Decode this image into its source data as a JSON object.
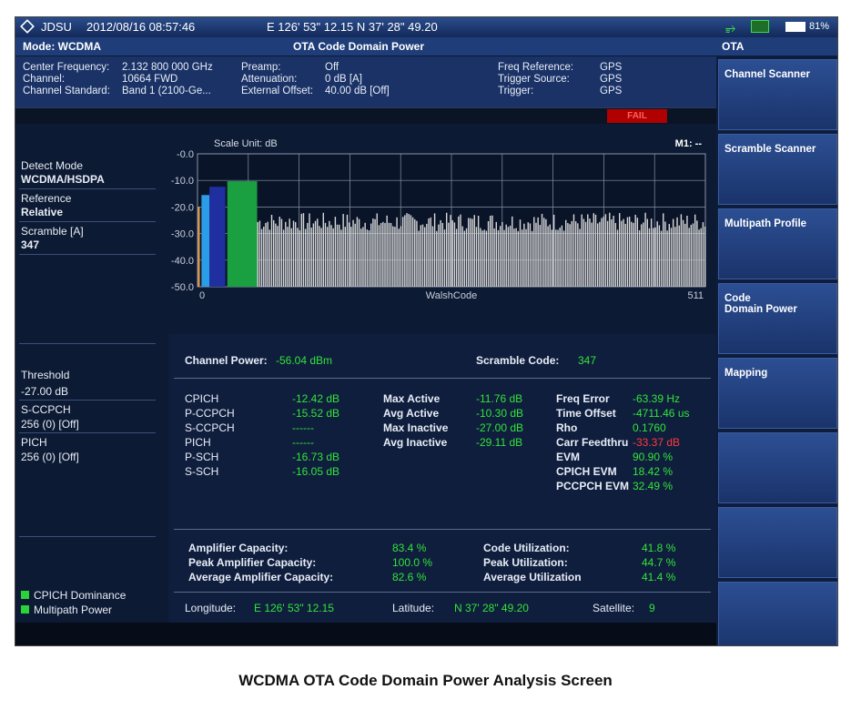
{
  "status": {
    "brand": "JDSU",
    "datetime": "2012/08/16 08:57:46",
    "gps": "E 126' 53\" 12.15  N 37' 28\" 49.20",
    "battery": "81%"
  },
  "header": {
    "mode": "Mode: WCDMA",
    "title": "OTA Code Domain Power"
  },
  "info": {
    "labels1": [
      "Center Frequency:",
      "Channel:",
      "Channel Standard:"
    ],
    "values1": [
      "2.132 800 000 GHz",
      "10664 FWD",
      "Band 1 (2100-Ge..."
    ],
    "labels2": [
      "Preamp:",
      "Attenuation:",
      "External Offset:"
    ],
    "values2": [
      "Off",
      "0 dB  [A]",
      "40.00 dB  [Off]"
    ],
    "labels3": [
      "Freq Reference:",
      "Trigger Source:",
      "Trigger:"
    ],
    "values3": [
      "GPS",
      "GPS",
      "GPS"
    ],
    "fail": "FAIL"
  },
  "left": {
    "detect_label": "Detect Mode",
    "detect_value": "WCDMA/HSDPA",
    "reference_label": "Reference",
    "reference_value": "Relative",
    "scramble_label": "Scramble [A]",
    "scramble_value": "347",
    "threshold_label": "Threshold",
    "threshold_value": "-27.00 dB",
    "sccpch_label": "S-CCPCH",
    "sccpch_value": "256 (0) [Off]",
    "pich_label": "PICH",
    "pich_value": "256 (0) [Off]",
    "legend1": "CPICH Dominance",
    "legend2": "Multipath Power"
  },
  "chart_data": {
    "type": "bar",
    "title": "Scale Unit: dB",
    "marker": "M1: --",
    "xlabel": "WalshCode",
    "x_ticks": [
      "0",
      "511"
    ],
    "y_ticks": [
      "-0.0",
      "-10.0",
      "-20.0",
      "-30.0",
      "-40.0",
      "-50.0"
    ],
    "ylim": [
      -50,
      0
    ],
    "xlim": [
      0,
      511
    ],
    "grid": true,
    "highlight_bars": [
      {
        "name": "P-CCPCH",
        "x_start": 4,
        "x_end": 12,
        "value": -15.5,
        "color": "#2b9de8"
      },
      {
        "name": "CPICH",
        "x_start": 12,
        "x_end": 28,
        "value": -12.4,
        "color": "#1f2fa0"
      },
      {
        "name": "S-CCPCH",
        "x_start": 30,
        "x_end": 60,
        "value": -10.3,
        "color": "#1aa040"
      }
    ],
    "noise_floor": -27.0,
    "noise_spread": 3.5,
    "noise_color": "#d8d8d8"
  },
  "meas": {
    "channel_power_label": "Channel Power:",
    "channel_power_value": "-56.04 dBm",
    "scramble_code_label": "Scramble Code:",
    "scramble_code_value": "347",
    "ch_names": [
      "CPICH",
      "P-CCPCH",
      "S-CCPCH",
      "PICH",
      "P-SCH",
      "S-SCH"
    ],
    "ch_values": [
      "-12.42 dB",
      "-15.52 dB",
      "------",
      "------",
      "-16.73 dB",
      "-16.05 dB"
    ],
    "act_names": [
      "Max Active",
      "Avg Active",
      "Max Inactive",
      "Avg Inactive"
    ],
    "act_values": [
      "-11.76 dB",
      "-10.30 dB",
      "-27.00 dB",
      "-29.11 dB"
    ],
    "err_names": [
      "Freq Error",
      "Time Offset",
      "Rho",
      "Carr Feedthru",
      "EVM",
      "CPICH EVM",
      "PCCPCH EVM"
    ],
    "err_values": [
      "-63.39 Hz",
      "-4711.46 us",
      "0.1760",
      "-33.37 dB",
      "90.90 %",
      "18.42 %",
      "32.49 %"
    ],
    "cap_labels": [
      "Amplifier Capacity:",
      "Peak Amplifier Capacity:",
      "Average Amplifier Capacity:"
    ],
    "cap_values": [
      "83.4 %",
      "100.0 %",
      "82.6 %"
    ],
    "util_labels": [
      "Code Utilization:",
      "Peak Utilization:",
      "Average Utilization"
    ],
    "util_values": [
      "41.8 %",
      "44.7 %",
      "41.4 %"
    ],
    "longitude_label": "Longitude:",
    "longitude_value": "E 126' 53\" 12.15",
    "latitude_label": "Latitude:",
    "latitude_value": "N 37' 28\" 49.20",
    "satellite_label": "Satellite:",
    "satellite_value": "9"
  },
  "softkeys": {
    "tab": "OTA",
    "keys": [
      "Channel Scanner",
      "Scramble Scanner",
      "Multipath Profile",
      "Code\nDomain Power",
      "Mapping",
      "",
      "",
      ""
    ]
  },
  "caption": "WCDMA OTA Code Domain Power Analysis Screen"
}
